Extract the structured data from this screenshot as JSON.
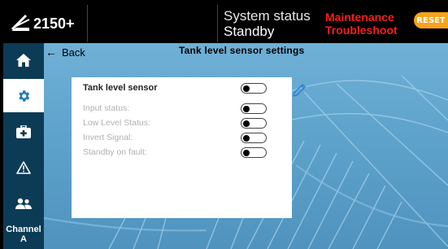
{
  "header": {
    "brand_name": "2150+",
    "status_label": "System status",
    "status_value": "Standby",
    "alerts": [
      "Maintenance",
      "Troubleshoot"
    ],
    "reset_label": "RESET"
  },
  "sidebar": {
    "items": [
      {
        "icon": "home-icon"
      },
      {
        "icon": "gear-icon",
        "active": true
      },
      {
        "icon": "first-aid-icon"
      },
      {
        "icon": "warning-icon"
      },
      {
        "icon": "users-icon"
      }
    ],
    "channel_label": "Channel",
    "channel_value": "A"
  },
  "page": {
    "back_label": "Back",
    "title": "Tank level sensor settings"
  },
  "panel": {
    "main_label": "Tank level sensor",
    "rows": [
      {
        "label": "Input status:",
        "on": false
      },
      {
        "label": "Low Level Status:",
        "on": false
      },
      {
        "label": "Invert Signal:",
        "on": false
      },
      {
        "label": "Standby on fault:",
        "on": false
      }
    ],
    "main_on": false
  },
  "colors": {
    "sidebar_bg": "#0c3b55",
    "main_bg": "#5ea3cc",
    "alert_red": "#ff1a1a",
    "reset_orange": "#f7a31c",
    "edit_blue": "#2a7fd4"
  }
}
